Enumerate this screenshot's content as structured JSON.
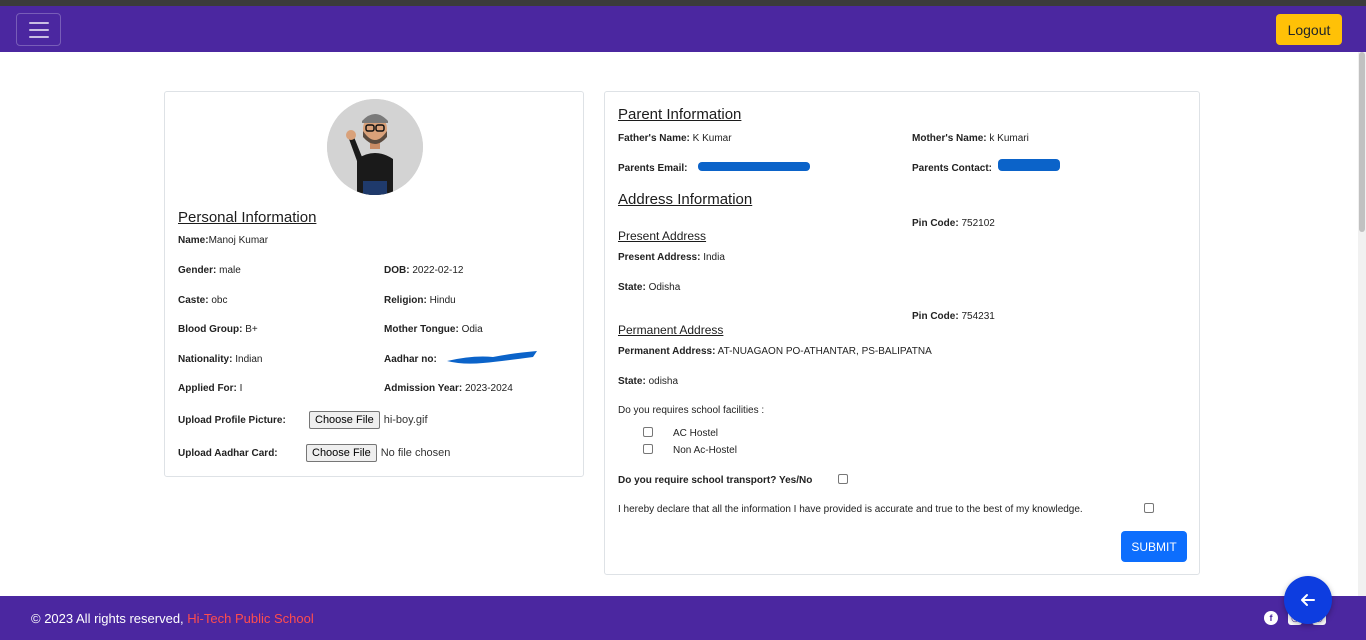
{
  "navbar": {
    "logout_label": "Logout"
  },
  "personal": {
    "section_title": "Personal Information",
    "name_label": "Name:",
    "name_value": "Manoj Kumar",
    "gender_label": "Gender:",
    "gender_value": "male",
    "dob_label": "DOB:",
    "dob_value": "2022-02-12",
    "caste_label": "Caste:",
    "caste_value": "obc",
    "religion_label": "Religion:",
    "religion_value": "Hindu",
    "blood_label": "Blood Group:",
    "blood_value": "B+",
    "mother_tongue_label": "Mother Tongue:",
    "mother_tongue_value": "Odia",
    "nationality_label": "Nationality:",
    "nationality_value": "Indian",
    "aadhar_label": "Aadhar no:",
    "applied_label": "Applied For:",
    "applied_value": "I",
    "admission_label": "Admission Year:",
    "admission_value": "2023-2024",
    "upload_profile_label": "Upload Profile Picture:",
    "upload_profile_button": "Choose File",
    "upload_profile_file": "hi-boy.gif",
    "upload_aadhar_label": "Upload Aadhar Card:",
    "upload_aadhar_button": "Choose File",
    "upload_aadhar_file": "No file chosen"
  },
  "parent": {
    "section_title": "Parent Information",
    "father_label": "Father's Name:",
    "father_value": "K Kumar",
    "mother_label": "Mother's Name:",
    "mother_value": "k Kumari",
    "email_label": "Parents Email:",
    "contact_label": "Parents Contact:"
  },
  "address": {
    "section_title": "Address Information",
    "present_pin_label": "Pin Code:",
    "present_pin_value": "752102",
    "present_subtitle": "Present Address",
    "present_address_label": "Present Address:",
    "present_address_value": "India",
    "present_state_label": "State:",
    "present_state_value": "Odisha",
    "permanent_pin_label": "Pin Code:",
    "permanent_pin_value": "754231",
    "permanent_subtitle": "Permanent Address",
    "permanent_address_label": "Permanent Address:",
    "permanent_address_value": "AT-NUAGAON PO-ATHANTAR, PS-BALIPATNA",
    "permanent_state_label": "State:",
    "permanent_state_value": "odisha"
  },
  "facilities": {
    "question": "Do you requires school facilities :",
    "options": [
      "AC Hostel",
      "Non Ac-Hostel"
    ],
    "transport_question": "Do you require school transport? Yes/No",
    "declaration": "I hereby declare that all the information I have provided is accurate and true to the best of my knowledge.",
    "submit_label": "SUBMIT"
  },
  "footer": {
    "copyright": "© 2023 All rights reserved,",
    "brand": "Hi-Tech Public School"
  },
  "colors": {
    "navbar": "#4b27a0",
    "logout": "#ffc107",
    "submit": "#0d6efd",
    "brand_text": "#ff4d4d",
    "fab": "#0d3de0"
  },
  "icons": [
    "hamburger-icon",
    "facebook-icon",
    "instagram-icon",
    "arrow-left-icon"
  ]
}
